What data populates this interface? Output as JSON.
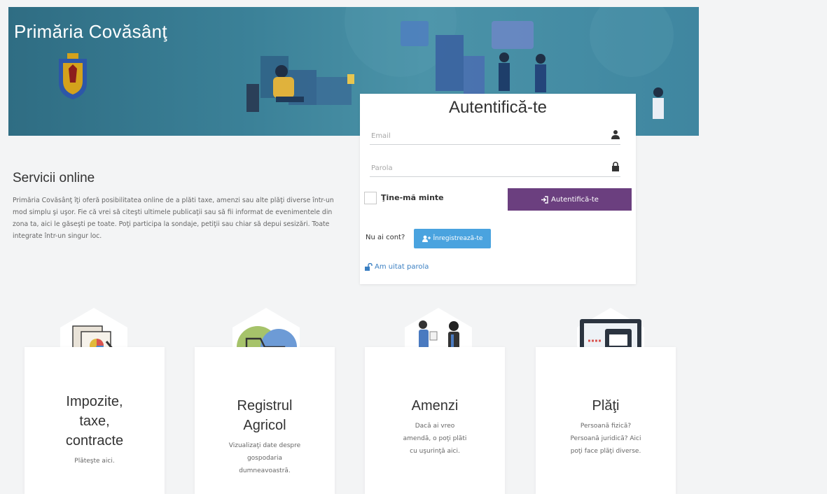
{
  "header": {
    "title": "Primăria Covăsânţ"
  },
  "login": {
    "title": "Autentifică-te",
    "email_placeholder": "Email",
    "password_placeholder": "Parola",
    "remember_label": "Ţine-mă minte",
    "submit_label": "Autentifică-te",
    "no_account_text": "Nu ai cont?",
    "register_label": "Înregistrează-te",
    "forgot_label": "Am uitat parola"
  },
  "services": {
    "title": "Servicii online",
    "description": "Primăria Covăsânţ îţi oferă posibilitatea online de a plăti taxe, amenzi sau alte plăţi diverse într-un mod simplu şi uşor. Fie că vrei să citeşti ultimele publicaţii sau să fii informat de evenimentele din zona ta, aici le găseşti pe toate. Poţi participa la sondaje, petiţii sau chiar să depui sesizări. Toate integrate într-un singur loc.",
    "cards": [
      {
        "title": "Impozite, taxe, contracte",
        "text": "Plăteşte aici.",
        "icon": "documents-chart-icon"
      },
      {
        "title": "Registrul Agricol",
        "text": "Vizualizaţi date despre gospodaria dumneavoastră.",
        "icon": "tractor-icon"
      },
      {
        "title": "Amenzi",
        "text": "Dacă ai vreo amendă, o poţi plăti cu uşurinţă aici.",
        "icon": "police-officer-icon"
      },
      {
        "title": "Plăţi",
        "text": "Persoană fizică? Persoană juridică? Aici poţi face plăţi diverse.",
        "icon": "computer-card-payment-icon"
      }
    ]
  },
  "colors": {
    "banner": "#3b8198",
    "login_button": "#6b3f7f",
    "register_button": "#4aa3df",
    "link": "#3a7fc2"
  }
}
